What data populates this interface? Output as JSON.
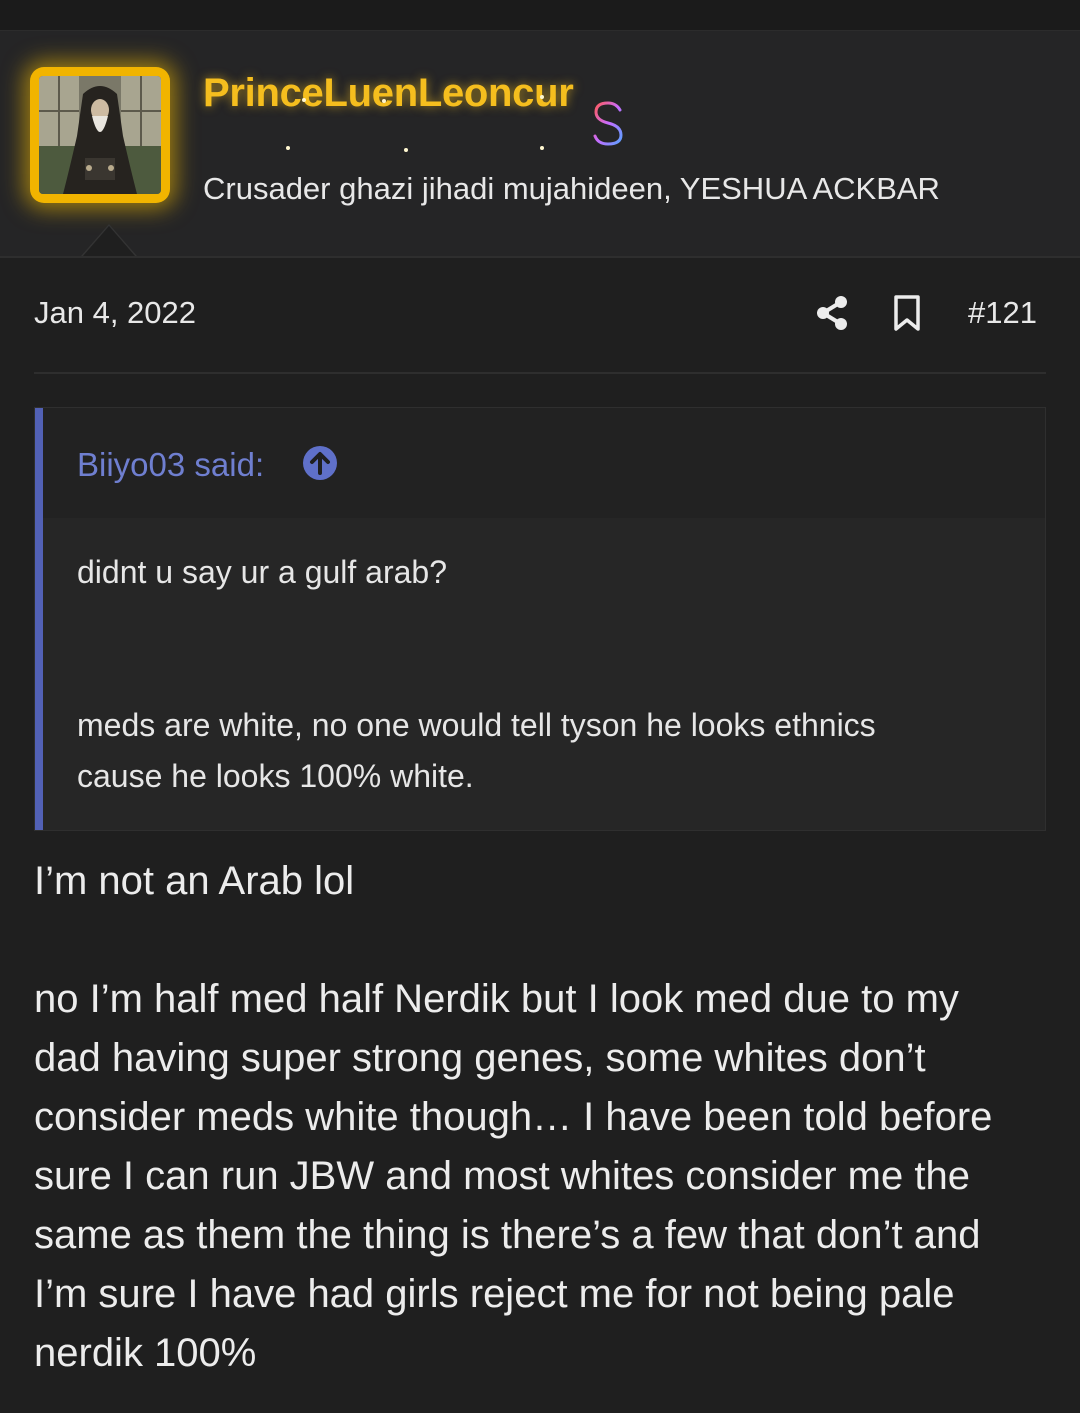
{
  "user": {
    "name": "PrinceLuenLeoncur",
    "title": "Crusader ghazi jihadi mujahideen, YESHUA ACKBAR",
    "name_color": "#f5be1e",
    "avatar_ring_color": "#f1b400",
    "badge_icon": "dollar-sign-icon"
  },
  "post": {
    "date": "Jan 4, 2022",
    "number": "#121",
    "share_icon": "share-icon",
    "bookmark_icon": "bookmark-icon"
  },
  "quote": {
    "author_label": "Biiyo03 said:",
    "jump_icon": "arrow-up-circle-icon",
    "accent_color": "#5261b5",
    "lines": [
      "didnt u say ur a gulf arab?",
      "meds are white, no one would tell tyson he looks ethnics",
      "cause he looks 100% white."
    ]
  },
  "reply": {
    "first": "I’m not an Arab lol",
    "lines": [
      "no I’m half med half Nerdik but I look med due to my",
      "dad having super strong genes, some whites don’t",
      "consider meds white though… I have been told before",
      "sure I can run JBW and most whites consider me the",
      "same as them the thing is there’s a few that don’t and",
      "I’m sure I have had girls reject me for not being pale",
      "nerdik 100%"
    ]
  }
}
